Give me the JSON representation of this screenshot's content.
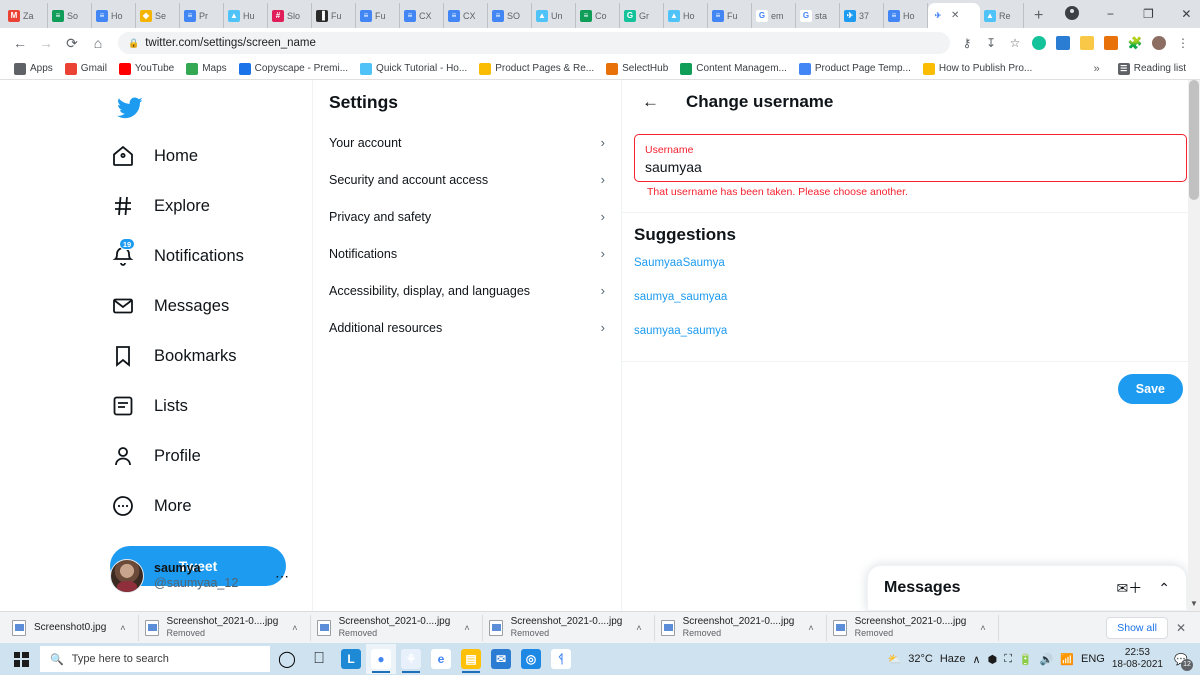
{
  "browser": {
    "tabs": [
      {
        "label": "Za",
        "icon": "gmail-icon",
        "color": "#ea4335",
        "glyph": "M",
        "active": false
      },
      {
        "label": "So",
        "icon": "sheets-icon",
        "color": "#0f9d58",
        "glyph": "≡",
        "active": false
      },
      {
        "label": "Ho",
        "icon": "docs-icon",
        "color": "#4285f4",
        "glyph": "≡",
        "active": false
      },
      {
        "label": "Se",
        "icon": "slides-icon",
        "color": "#f4b400",
        "glyph": "◆",
        "active": false
      },
      {
        "label": "Pr",
        "icon": "docs-icon",
        "color": "#4285f4",
        "glyph": "≡",
        "active": false
      },
      {
        "label": "Hu",
        "icon": "drive-icon",
        "color": "#4fc3f7",
        "glyph": "▲",
        "active": false
      },
      {
        "label": "Slo",
        "icon": "slack-icon",
        "color": "#e01e5a",
        "glyph": "#",
        "active": false
      },
      {
        "label": "Fu",
        "icon": "book-icon",
        "color": "#2b2b2b",
        "glyph": "▐",
        "active": false
      },
      {
        "label": "Fu",
        "icon": "docs-icon",
        "color": "#4285f4",
        "glyph": "≡",
        "active": false
      },
      {
        "label": "CX",
        "icon": "docs-icon",
        "color": "#4285f4",
        "glyph": "≡",
        "active": false
      },
      {
        "label": "CX",
        "icon": "docs-icon",
        "color": "#4285f4",
        "glyph": "≡",
        "active": false
      },
      {
        "label": "SO",
        "icon": "docs-icon",
        "color": "#4285f4",
        "glyph": "≡",
        "active": false
      },
      {
        "label": "Un",
        "icon": "drive-icon",
        "color": "#4fc3f7",
        "glyph": "▲",
        "active": false
      },
      {
        "label": "Co",
        "icon": "sheets-icon",
        "color": "#0f9d58",
        "glyph": "≡",
        "active": false
      },
      {
        "label": "Gr",
        "icon": "grammarly-icon",
        "color": "#15c39a",
        "glyph": "G",
        "active": false
      },
      {
        "label": "Ho",
        "icon": "drive-icon",
        "color": "#4fc3f7",
        "glyph": "▲",
        "active": false
      },
      {
        "label": "Fu",
        "icon": "docs-icon",
        "color": "#4285f4",
        "glyph": "≡",
        "active": false
      },
      {
        "label": "em",
        "icon": "google-icon",
        "color": "#ffffff",
        "glyph": "G",
        "active": false
      },
      {
        "label": "sta",
        "icon": "google-icon",
        "color": "#ffffff",
        "glyph": "G",
        "active": false
      },
      {
        "label": "37",
        "icon": "twitter-icon",
        "color": "#1d9bf0",
        "glyph": "✈",
        "active": false
      },
      {
        "label": "Ho",
        "icon": "docs-icon",
        "color": "#4285f4",
        "glyph": "≡",
        "active": false
      },
      {
        "label": "",
        "icon": "twitter-icon",
        "color": "#ffffff",
        "glyph": "✈",
        "active": true
      },
      {
        "label": "Re",
        "icon": "drive-icon",
        "color": "#4fc3f7",
        "glyph": "▲",
        "active": false
      }
    ],
    "new_tab_label": "+",
    "window_controls": {
      "minimize": "−",
      "maximize": "❐",
      "close": "✕"
    },
    "nav": {
      "back": "←",
      "forward": "→",
      "reload": "⟳",
      "home": "⌂"
    },
    "url": "twitter.com/settings/screen_name",
    "lock_icon": "lock-icon",
    "omnibox_icons": [
      "key-icon",
      "install-icon",
      "bookmark-star-icon"
    ],
    "extensions": [
      "grammarly-ext-icon",
      "calculator-ext-icon",
      "sidebar-ext-icon",
      "notes-ext-icon",
      "puzzle-ext-icon"
    ],
    "profile_avatar": "profile-avatar",
    "menu_icon": "kebab-menu-icon",
    "bookmarks": [
      {
        "label": "Apps",
        "icon": "apps-grid-icon",
        "color": "#5f6368"
      },
      {
        "label": "Gmail",
        "icon": "gmail-icon",
        "color": "#ea4335"
      },
      {
        "label": "YouTube",
        "icon": "youtube-icon",
        "color": "#ff0000"
      },
      {
        "label": "Maps",
        "icon": "maps-icon",
        "color": "#34a853"
      },
      {
        "label": "Copyscape - Premi...",
        "icon": "copyscape-icon",
        "color": "#1a73e8"
      },
      {
        "label": "Quick Tutorial - Ho...",
        "icon": "drive-icon",
        "color": "#4fc3f7"
      },
      {
        "label": "Product Pages & Re...",
        "icon": "folder-icon",
        "color": "#fbbc04"
      },
      {
        "label": "SelectHub",
        "icon": "selecthub-icon",
        "color": "#e8710a"
      },
      {
        "label": "Content Managem...",
        "icon": "sheets-icon",
        "color": "#0f9d58"
      },
      {
        "label": "Product Page Temp...",
        "icon": "google-icon",
        "color": "#4285f4"
      },
      {
        "label": "How to Publish Pro...",
        "icon": "folder-icon",
        "color": "#fbbc04"
      }
    ],
    "bookmarks_overflow": "»",
    "reading_list": "Reading list",
    "reading_list_icon": "reading-list-icon"
  },
  "twitter": {
    "logo_icon": "twitter-bird-icon",
    "nav_items": [
      {
        "label": "Home",
        "icon": "home-icon",
        "badge": null
      },
      {
        "label": "Explore",
        "icon": "hashtag-icon",
        "badge": null
      },
      {
        "label": "Notifications",
        "icon": "bell-icon",
        "badge": "19"
      },
      {
        "label": "Messages",
        "icon": "envelope-icon",
        "badge": null
      },
      {
        "label": "Bookmarks",
        "icon": "bookmark-icon",
        "badge": null
      },
      {
        "label": "Lists",
        "icon": "list-icon",
        "badge": null
      },
      {
        "label": "Profile",
        "icon": "person-icon",
        "badge": null
      },
      {
        "label": "More",
        "icon": "more-circle-icon",
        "badge": null
      }
    ],
    "tweet_button": "Tweet",
    "account": {
      "display_name": "saumya",
      "handle": "@saumyaa_12",
      "more_icon": "ellipsis-icon"
    },
    "settings": {
      "title": "Settings",
      "items": [
        {
          "label": "Your account"
        },
        {
          "label": "Security and account access"
        },
        {
          "label": "Privacy and safety"
        },
        {
          "label": "Notifications"
        },
        {
          "label": "Accessibility, display, and languages"
        },
        {
          "label": "Additional resources"
        }
      ],
      "chevron": "›"
    },
    "detail": {
      "back_icon": "back-arrow-icon",
      "title": "Change username",
      "field_label": "Username",
      "field_value": "saumyaa",
      "field_placeholder": "Username",
      "error": "That username has been taken. Please choose another.",
      "error_color": "#f4212e",
      "suggestions_title": "Suggestions",
      "suggestions": [
        "SaumyaaSaumya",
        "saumya_saumyaa",
        "saumyaa_saumya"
      ],
      "save_label": "Save",
      "accent_color": "#1d9bf0"
    },
    "messages_dock": {
      "title": "Messages",
      "new_message_icon": "new-message-icon",
      "expand_icon": "chevron-up-double-icon"
    }
  },
  "downloads": {
    "items": [
      {
        "name": "Screenshot0.jpg",
        "status": ""
      },
      {
        "name": "Screenshot_2021-0....jpg",
        "status": "Removed"
      },
      {
        "name": "Screenshot_2021-0....jpg",
        "status": "Removed"
      },
      {
        "name": "Screenshot_2021-0....jpg",
        "status": "Removed"
      },
      {
        "name": "Screenshot_2021-0....jpg",
        "status": "Removed"
      },
      {
        "name": "Screenshot_2021-0....jpg",
        "status": "Removed"
      }
    ],
    "caret": "˄",
    "show_all": "Show all",
    "close": "✕"
  },
  "taskbar": {
    "start_icon": "windows-start-icon",
    "search_placeholder": "Type here to search",
    "search_icon": "search-icon",
    "cortana_icon": "cortana-circle-icon",
    "taskview_icon": "task-view-icon",
    "apps": [
      {
        "icon": "lightshot-icon",
        "color": "#1e8ad6",
        "glyph": "L",
        "running": false
      },
      {
        "icon": "chrome-icon",
        "color": "#ffffff",
        "glyph": "●",
        "running": true,
        "active": true
      },
      {
        "icon": "teams-icon",
        "color": "#e8f1fb",
        "glyph": "⚘",
        "running": true
      },
      {
        "icon": "edge-icon",
        "color": "#ffffff",
        "glyph": "e",
        "running": false
      },
      {
        "icon": "file-explorer-icon",
        "color": "#ffc107",
        "glyph": "▤",
        "running": true
      },
      {
        "icon": "mail-icon",
        "color": "#2b7cd3",
        "glyph": "✉",
        "running": false
      },
      {
        "icon": "photos-icon",
        "color": "#1e88e5",
        "glyph": "◎",
        "running": false
      },
      {
        "icon": "firefox-icon",
        "color": "#ffffff",
        "glyph": "ᛩ",
        "running": false
      }
    ],
    "weather": {
      "temp": "32°C",
      "condition": "Haze",
      "icon": "haze-icon"
    },
    "tray_expand": "∧",
    "tray_icons": [
      "dropbox-icon",
      "camera-icon",
      "battery-icon",
      "volume-icon",
      "wifi-icon"
    ],
    "language": "ENG",
    "time": "22:53",
    "date": "18-08-2021",
    "notification_icon": "action-center-icon",
    "notification_count": "12"
  }
}
